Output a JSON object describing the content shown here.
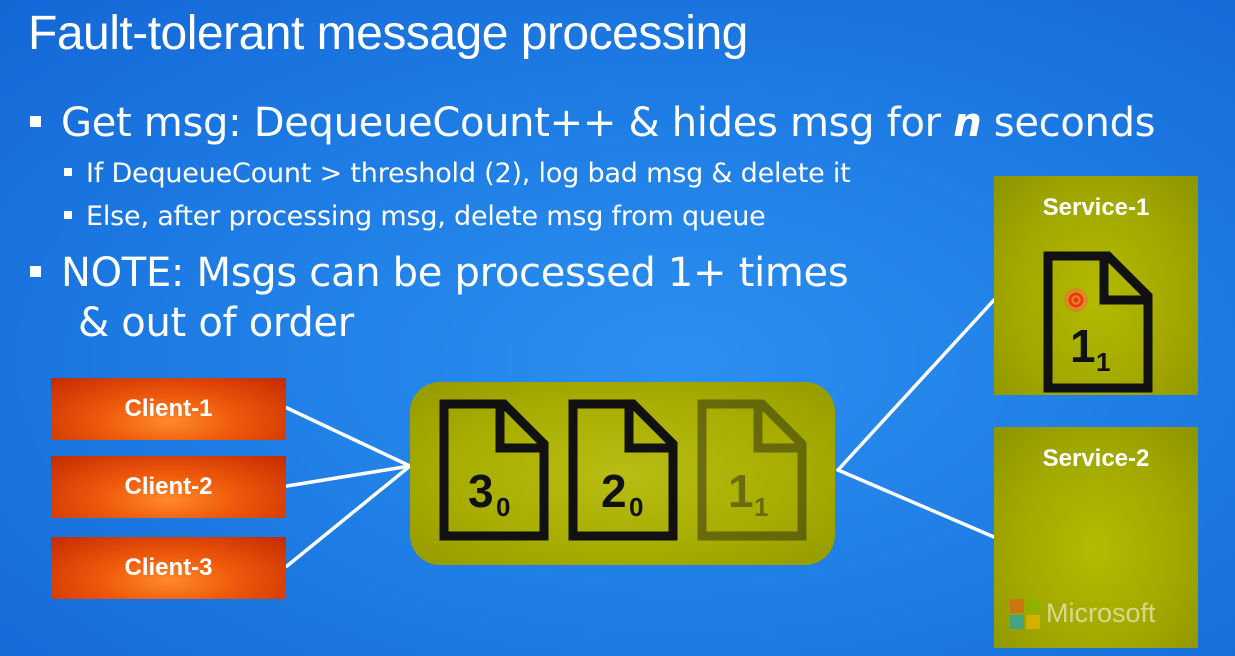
{
  "title": "Fault-tolerant message processing",
  "bullets": {
    "b1_prefix": "Get msg: DequeueCount++ & hides msg for ",
    "b1_italic": "n",
    "b1_suffix": " seconds",
    "sub1": "If DequeueCount > threshold (2), log bad msg & delete it",
    "sub2": "Else, after processing msg, delete msg from queue",
    "note_line1": "NOTE: Msgs can be processed 1+ times",
    "note_line2": "& out of order"
  },
  "clients": [
    "Client-1",
    "Client-2",
    "Client-3"
  ],
  "queue_messages": [
    {
      "id": "3",
      "dequeue_count": "0"
    },
    {
      "id": "2",
      "dequeue_count": "0"
    },
    {
      "id": "1",
      "dequeue_count": "1"
    }
  ],
  "services": {
    "s1_label": "Service-1",
    "s1_message": {
      "id": "1",
      "dequeue_count": "1"
    },
    "s2_label": "Service-2"
  },
  "brand": {
    "name": "Microsoft",
    "logo_colors": [
      "#f25022",
      "#7fba00",
      "#00a4ef",
      "#ffb900"
    ]
  },
  "colors": {
    "background": "#1f7fe6",
    "client": "#e8500a",
    "queue": "#a6ac00",
    "service": "#a0a700",
    "doc_stroke": "#111111"
  }
}
